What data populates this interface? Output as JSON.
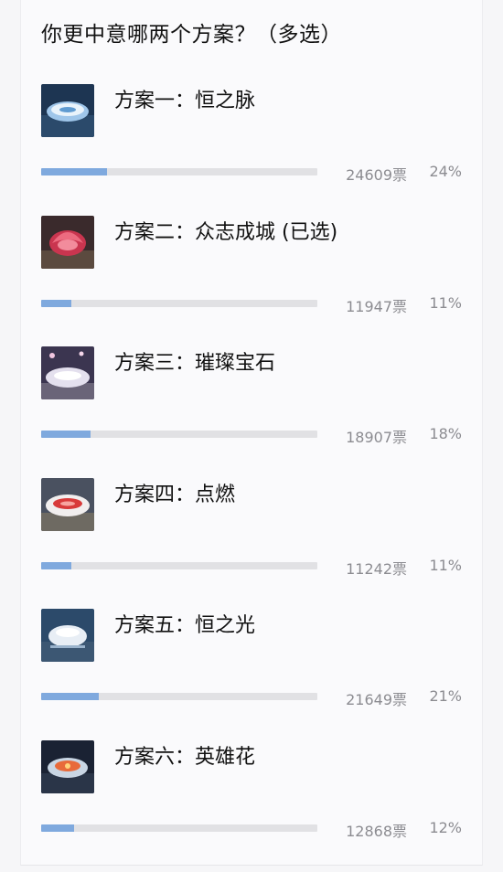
{
  "poll": {
    "question": "你更中意哪两个方案？（多选）",
    "options": [
      {
        "label": "方案一：恒之脉",
        "votes": "24609票",
        "percent": "24%",
        "fraction": 0.24,
        "thumb_color": "#2f6fb3",
        "thumb_icon": "stadium-blue-icon"
      },
      {
        "label": "方案二：众志成城 (已选)",
        "votes": "11947票",
        "percent": "11%",
        "fraction": 0.11,
        "thumb_color": "#d8475a",
        "thumb_icon": "stadium-red-lotus-icon"
      },
      {
        "label": "方案三：璀璨宝石",
        "votes": "18907票",
        "percent": "18%",
        "fraction": 0.18,
        "thumb_color": "#c9c3d6",
        "thumb_icon": "stadium-gem-icon"
      },
      {
        "label": "方案四：点燃",
        "votes": "11242票",
        "percent": "11%",
        "fraction": 0.11,
        "thumb_color": "#d24a47",
        "thumb_icon": "stadium-ignite-icon"
      },
      {
        "label": "方案五：恒之光",
        "votes": "21649票",
        "percent": "21%",
        "fraction": 0.21,
        "thumb_color": "#e9eef3",
        "thumb_icon": "stadium-light-icon"
      },
      {
        "label": "方案六：英雄花",
        "votes": "12868票",
        "percent": "12%",
        "fraction": 0.12,
        "thumb_color": "#e26b3b",
        "thumb_icon": "stadium-flower-icon"
      }
    ]
  },
  "colors": {
    "bar_fill": "#7fa9de",
    "bar_track": "#e1e1e4",
    "meta_text": "#8c8c91"
  }
}
